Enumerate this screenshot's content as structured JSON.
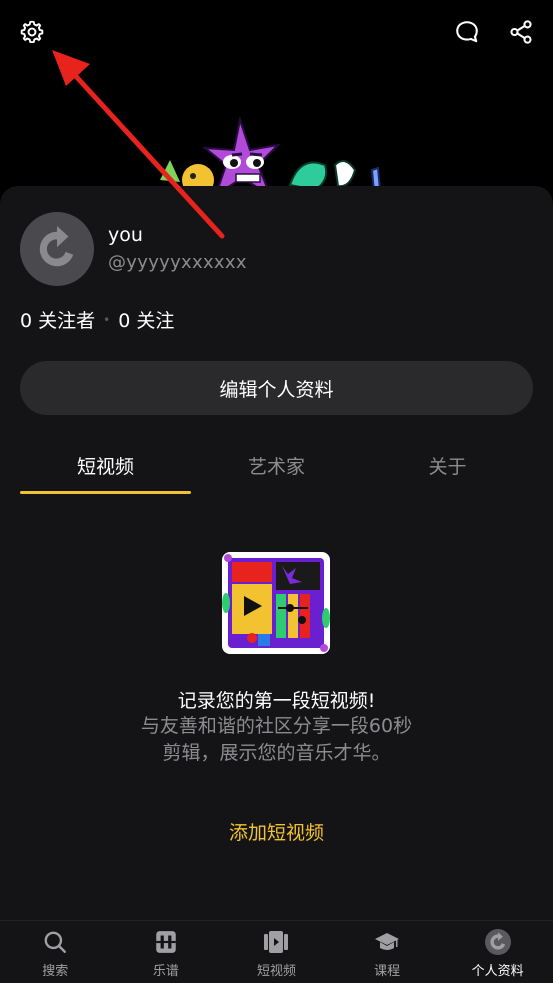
{
  "header": {
    "settings_icon": "gear-icon",
    "comment_icon": "chat-bubble-icon",
    "share_icon": "share-icon"
  },
  "profile": {
    "name": "you",
    "handle": "@yyyyyxxxxxx",
    "followers": "0 关注者",
    "following": "0 关注",
    "separator": "•",
    "edit_button": "编辑个人资料"
  },
  "tabs": [
    {
      "label": "短视频",
      "active": true
    },
    {
      "label": "艺术家",
      "active": false
    },
    {
      "label": "关于",
      "active": false
    }
  ],
  "empty_state": {
    "title": "记录您的第一段短视频!",
    "description": "与友善和谐的社区分享一段60秒剪辑，展示您的音乐才华。",
    "action": "添加短视频"
  },
  "bottom_nav": [
    {
      "label": "搜索",
      "icon": "search-icon"
    },
    {
      "label": "乐谱",
      "icon": "sheet-music-icon"
    },
    {
      "label": "短视频",
      "icon": "video-icon"
    },
    {
      "label": "课程",
      "icon": "graduation-cap-icon"
    },
    {
      "label": "个人资料",
      "icon": "profile-avatar-icon",
      "active": true
    }
  ],
  "colors": {
    "background": "#000000",
    "card": "#141416",
    "accent": "#f2c230",
    "muted_text": "#8c8c90",
    "annotation_arrow": "#e8231e"
  }
}
